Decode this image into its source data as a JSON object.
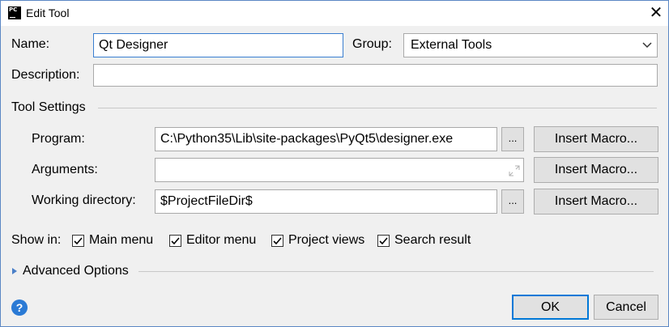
{
  "window": {
    "title": "Edit Tool",
    "app_icon_text": "PC",
    "close_glyph": "✕"
  },
  "name": {
    "label": "Name:",
    "value": "Qt Designer"
  },
  "group": {
    "label": "Group:",
    "value": "External Tools"
  },
  "description": {
    "label": "Description:",
    "value": ""
  },
  "tool_settings": {
    "heading": "Tool Settings",
    "program": {
      "label": "Program:",
      "value": "C:\\Python35\\Lib\\site-packages\\PyQt5\\designer.exe"
    },
    "arguments": {
      "label": "Arguments:",
      "value": ""
    },
    "working_directory": {
      "label": "Working directory:",
      "value": "$ProjectFileDir$"
    },
    "browse_label": "...",
    "insert_macro_label": "Insert Macro..."
  },
  "show_in": {
    "label": "Show in:",
    "options": [
      {
        "label": "Main menu",
        "checked": true
      },
      {
        "label": "Editor menu",
        "checked": true
      },
      {
        "label": "Project views",
        "checked": true
      },
      {
        "label": "Search result",
        "checked": true
      }
    ]
  },
  "advanced_options": {
    "label": "Advanced Options",
    "expanded": false
  },
  "footer": {
    "help_glyph": "?",
    "ok_label": "OK",
    "cancel_label": "Cancel"
  },
  "colors": {
    "accent": "#0078d7",
    "focus_border": "#3a7ed0",
    "help_icon": "#2a7ad5"
  }
}
